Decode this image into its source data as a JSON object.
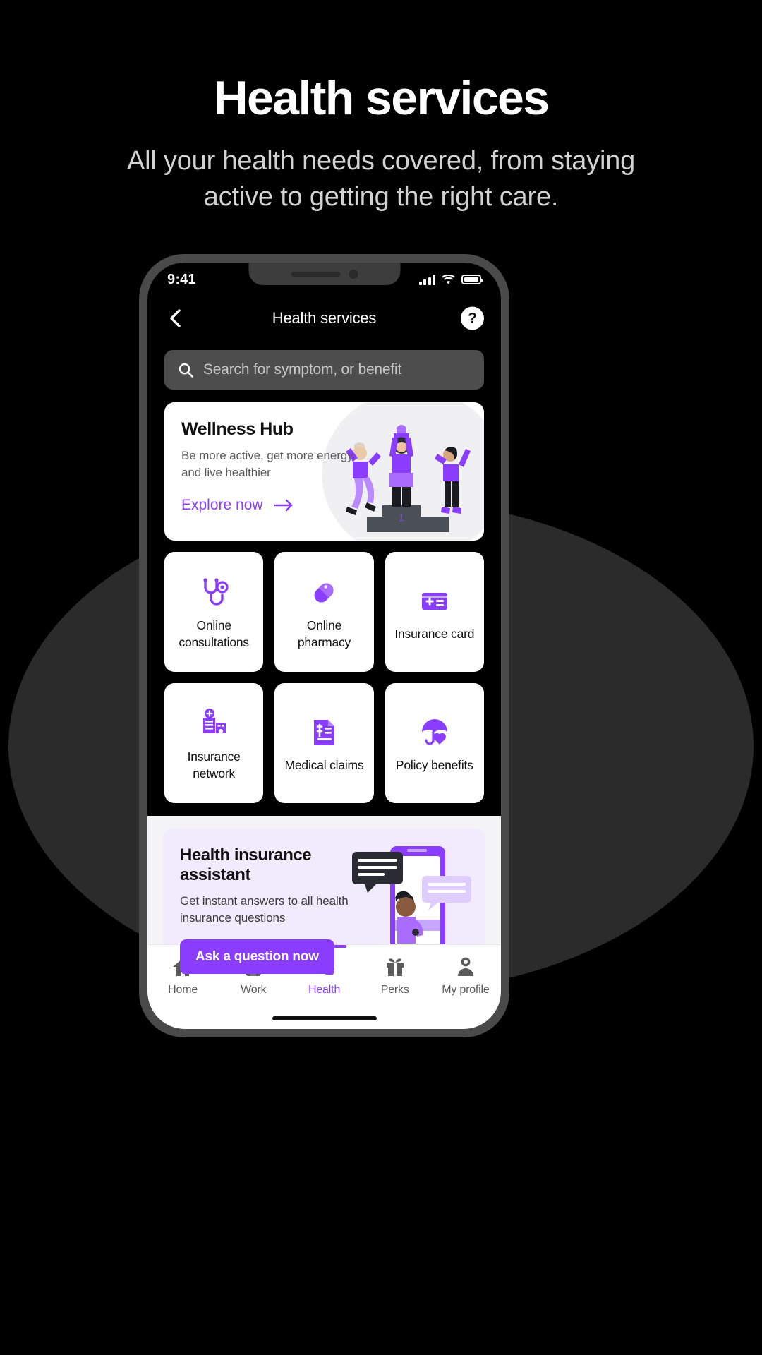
{
  "hero": {
    "title": "Health services",
    "subtitle": "All your health needs covered, from staying active to getting the right care."
  },
  "colors": {
    "accent": "#8B3DFF",
    "page_background": "#000000",
    "card_background": "#FFFFFF",
    "assistant_card_background": "#F2EBFE",
    "light_section_background": "#F4F4F6",
    "backdrop_ellipse": "#2B2B2B",
    "search_field": "#4D4D4D"
  },
  "phone": {
    "status_bar": {
      "time": "9:41",
      "signal_icon": "cellular-signal-icon",
      "wifi_icon": "wifi-icon",
      "battery_icon": "battery-full-icon"
    },
    "header": {
      "back_icon": "chevron-left-icon",
      "title": "Health services",
      "help_label": "?",
      "help_icon": "question-mark-icon"
    },
    "search": {
      "icon": "search-icon",
      "placeholder": "Search for symptom, or benefit",
      "value": ""
    },
    "promo": {
      "title": "Wellness Hub",
      "description": "Be more active, get more energy, and live healthier",
      "cta_label": "Explore now",
      "cta_icon": "arrow-right-icon",
      "illustration": "podium-winners-illustration"
    },
    "tiles": [
      {
        "label": "Online consultations",
        "icon": "stethoscope-icon"
      },
      {
        "label": "Online pharmacy",
        "icon": "pill-capsule-icon"
      },
      {
        "label": "Insurance card",
        "icon": "insurance-card-icon"
      },
      {
        "label": "Insurance network",
        "icon": "hospital-building-icon"
      },
      {
        "label": "Medical claims",
        "icon": "invoice-document-icon"
      },
      {
        "label": "Policy benefits",
        "icon": "umbrella-heart-icon"
      }
    ],
    "assistant": {
      "title": "Health insurance assistant",
      "description": "Get instant answers to all health insurance questions",
      "button_label": "Ask a question now",
      "illustration": "person-chat-phone-illustration"
    },
    "tabs": [
      {
        "label": "Home",
        "icon": "home-icon",
        "active": false
      },
      {
        "label": "Work",
        "icon": "briefcase-icon",
        "active": false
      },
      {
        "label": "Health",
        "icon": "health-person-kit-icon",
        "active": true
      },
      {
        "label": "Perks",
        "icon": "gift-icon",
        "active": false
      },
      {
        "label": "My profile",
        "icon": "person-icon",
        "active": false
      }
    ]
  }
}
